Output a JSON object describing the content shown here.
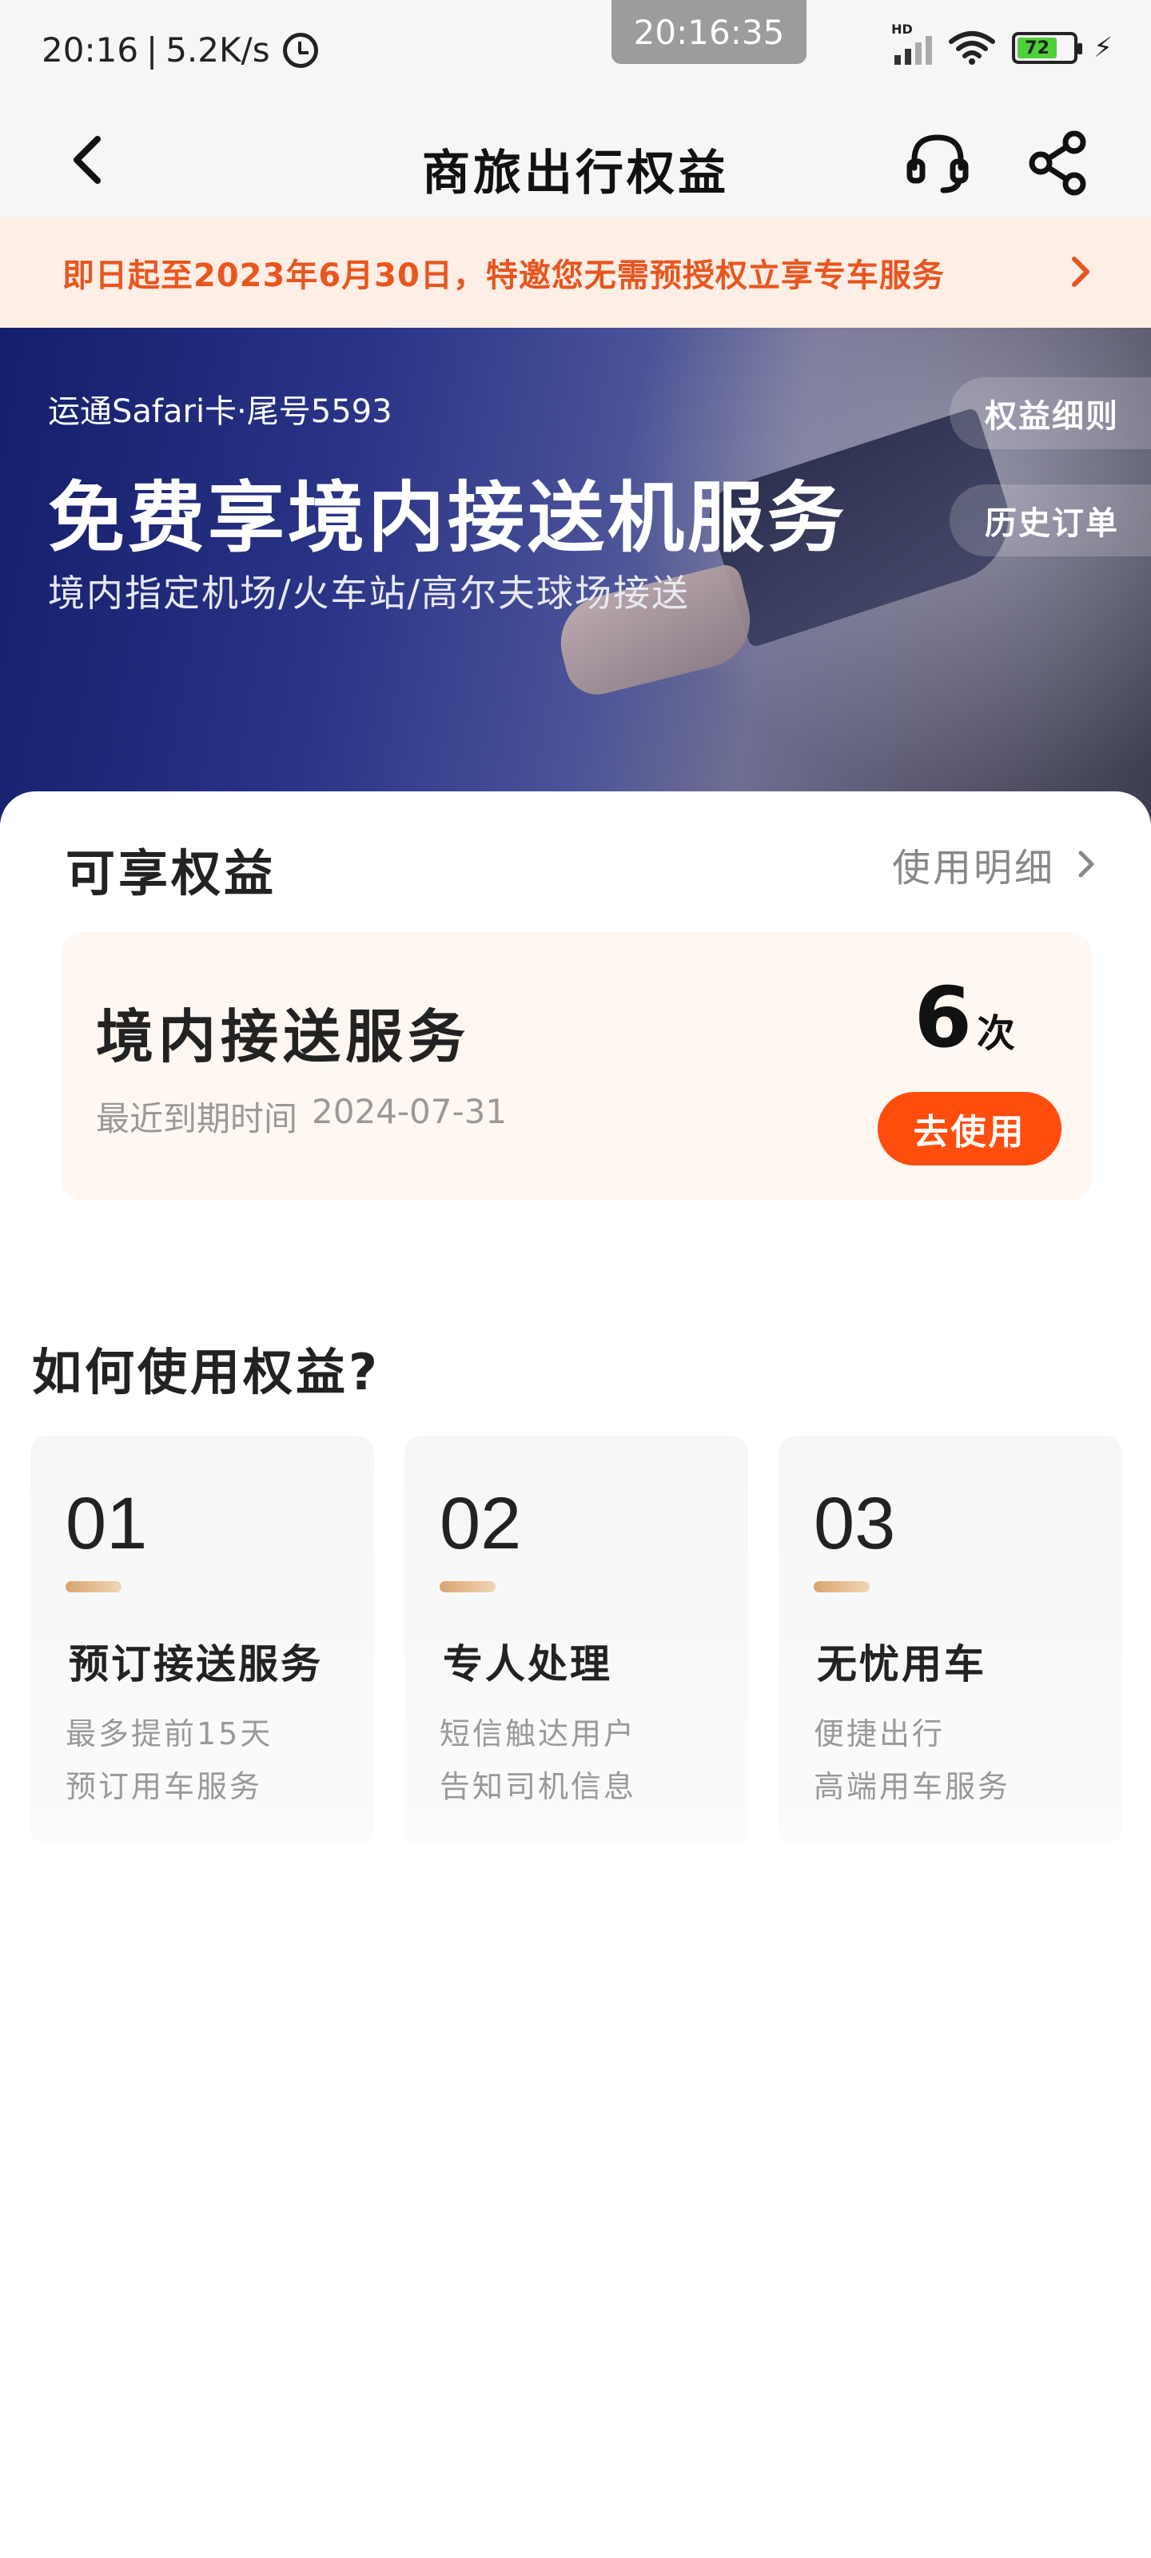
{
  "status_bar": {
    "time": "20:16",
    "separator": "|",
    "net_speed": "5.2K/s",
    "floating_clock": "20:16:35",
    "hd_label": "HD",
    "battery_level": "72"
  },
  "header": {
    "title": "商旅出行权益"
  },
  "notice": {
    "text": "即日起至2023年6月30日，特邀您无需预授权立享专车服务"
  },
  "hero": {
    "card_label": "运通Safari卡·尾号5593",
    "title": "免费享境内接送机服务",
    "subtitle": "境内指定机场/火车站/高尔夫球场接送",
    "rules_btn": "权益细则",
    "history_btn": "历史订单"
  },
  "benefits": {
    "section_title": "可享权益",
    "detail_link": "使用明细",
    "card": {
      "name": "境内接送服务",
      "expiry_label": "最近到期时间",
      "expiry_date": "2024-07-31",
      "count": "6",
      "count_unit": "次",
      "use_btn": "去使用"
    }
  },
  "how_to": {
    "title": "如何使用权益?",
    "steps": [
      {
        "num": "01",
        "title": "预订接送服务",
        "line1": "最多提前15天",
        "line2": "预订用车服务"
      },
      {
        "num": "02",
        "title": "专人处理",
        "line1": "短信触达用户",
        "line2": "告知司机信息"
      },
      {
        "num": "03",
        "title": "无忧用车",
        "line1": "便捷出行",
        "line2": "高端用车服务"
      }
    ]
  },
  "colors": {
    "accent": "#ff4d0d",
    "notice_text": "#e8561e",
    "notice_bg": "#fdeee6",
    "hero_bg": "#1c2470"
  }
}
